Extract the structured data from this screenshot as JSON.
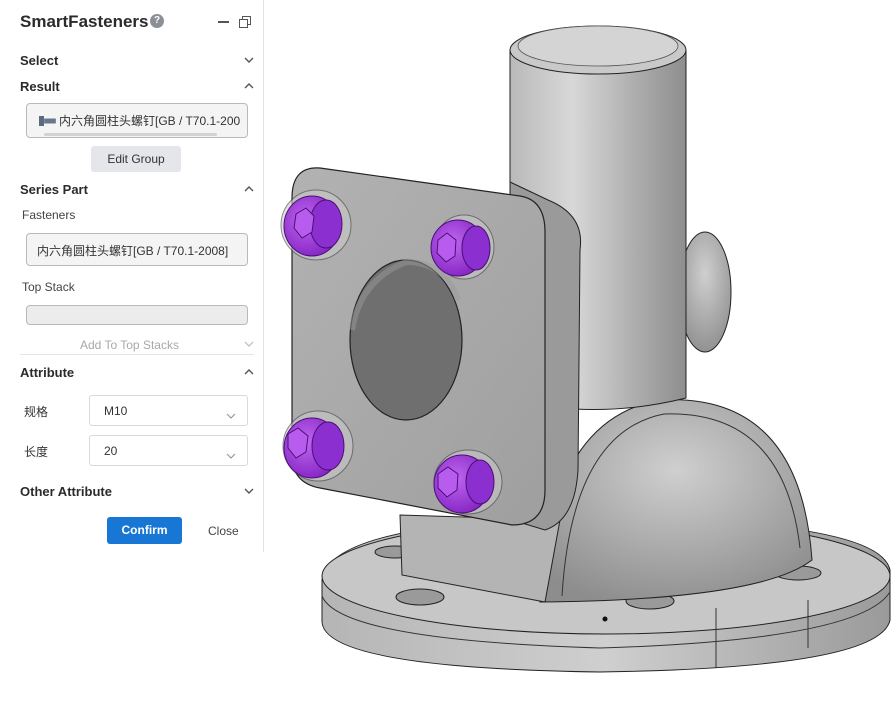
{
  "panel": {
    "title": "SmartFasteners",
    "help_icon": "?",
    "sections": {
      "select": "Select",
      "result": "Result",
      "series_part": "Series Part",
      "attribute": "Attribute",
      "other_attribute": "Other Attribute"
    },
    "result": {
      "item_text": "内六角圆柱头螺钉[GB / T70.1-200",
      "edit_group_label": "Edit Group"
    },
    "series_part": {
      "fasteners_label": "Fasteners",
      "fasteners_value": "内六角圆柱头螺钉[GB / T70.1-2008]",
      "top_stack_label": "Top Stack",
      "top_stack_value": "",
      "add_to_top_stacks_label": "Add To Top Stacks"
    },
    "attribute": {
      "rows": [
        {
          "label": "规格",
          "value": "M10"
        },
        {
          "label": "长度",
          "value": "20"
        }
      ]
    },
    "buttons": {
      "confirm": "Confirm",
      "close": "Close"
    }
  },
  "colors": {
    "accent": "#1876d4",
    "fastener": "#a13be0",
    "part_gray": "#a9a9a9"
  },
  "icons": [
    "help-icon",
    "minimize-icon",
    "restore-icon",
    "chevron-down-icon",
    "chevron-up-icon",
    "screw-icon"
  ]
}
